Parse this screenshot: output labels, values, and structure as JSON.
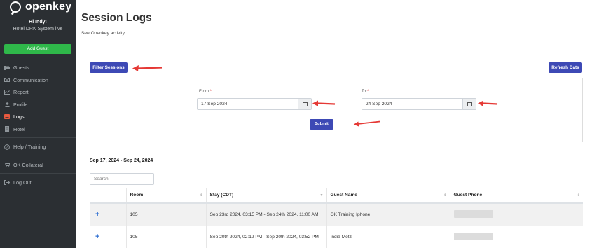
{
  "sidebar": {
    "brand": "openkey",
    "greeting": "Hi Indy!",
    "hotel": "Hotel DRK System live",
    "add_guest": "Add Guest",
    "items": [
      {
        "label": "Guests",
        "icon": "bed-icon"
      },
      {
        "label": "Communication",
        "icon": "envelope-icon"
      },
      {
        "label": "Report",
        "icon": "chart-icon"
      },
      {
        "label": "Profile",
        "icon": "user-icon"
      },
      {
        "label": "Logs",
        "icon": "logs-icon",
        "active": true
      },
      {
        "label": "Hotel",
        "icon": "building-icon"
      }
    ],
    "help": "Help / Training",
    "collateral": "OK Collateral",
    "logout": "Log Out"
  },
  "page": {
    "title": "Session Logs",
    "subtitle": "See Openkey activity."
  },
  "toolbar": {
    "filter_label": "Filter Sessions",
    "refresh_label": "Refresh Data"
  },
  "filter": {
    "from_label": "From:",
    "from_value": "17 Sep 2024",
    "to_label": "To:",
    "to_value": "24 Sep 2024",
    "required_mark": "*",
    "submit_label": "Submit"
  },
  "results": {
    "range_heading": "Sep 17, 2024 - Sep 24, 2024",
    "search_placeholder": "Search",
    "columns": [
      "Room",
      "Stay (CDT)",
      "Guest Name",
      "Guest Phone"
    ],
    "rows": [
      {
        "room": "105",
        "stay": "Sep 23rd 2024, 03:15 PM - Sep 24th 2024, 11:00 AM",
        "guest_name": "OK Training Iphone"
      },
      {
        "room": "105",
        "stay": "Sep 20th 2024, 02:12 PM - Sep 20th 2024, 03:52 PM",
        "guest_name": "India Metz"
      }
    ]
  },
  "colors": {
    "sidebar_bg": "#2b2f33",
    "primary_button": "#3d49b5",
    "add_guest_button": "#2fb84a",
    "annotation_arrow": "#e53935"
  }
}
